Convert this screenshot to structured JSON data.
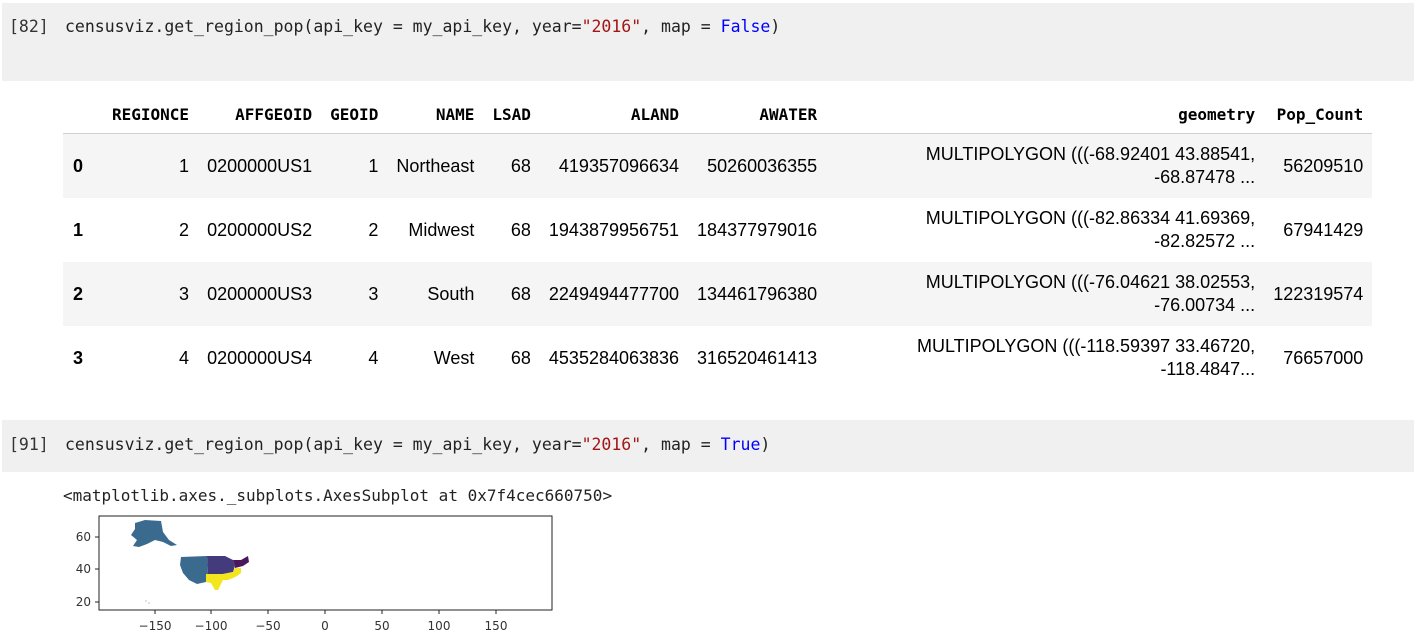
{
  "cells": [
    {
      "prompt": "[82]",
      "code_parts": [
        "censusviz.get_region_pop(api_key = my_api_key, year=",
        "\"2016\"",
        ", map = ",
        "False",
        ")"
      ]
    },
    {
      "prompt": "[91]",
      "code_parts": [
        "censusviz.get_region_pop(api_key = my_api_key, year=",
        "\"2016\"",
        ", map = ",
        "True",
        ")"
      ]
    }
  ],
  "dataframe": {
    "columns": [
      "",
      "REGIONCE",
      "AFFGEOID",
      "GEOID",
      "NAME",
      "LSAD",
      "ALAND",
      "AWATER",
      "geometry",
      "Pop_Count"
    ],
    "rows": [
      {
        "idx": "0",
        "REGIONCE": "1",
        "AFFGEOID": "0200000US1",
        "GEOID": "1",
        "NAME": "Northeast",
        "LSAD": "68",
        "ALAND": "419357096634",
        "AWATER": "50260036355",
        "geometry_1": "MULTIPOLYGON (((-68.92401 43.88541,",
        "geometry_2": "-68.87478 ...",
        "Pop_Count": "56209510"
      },
      {
        "idx": "1",
        "REGIONCE": "2",
        "AFFGEOID": "0200000US2",
        "GEOID": "2",
        "NAME": "Midwest",
        "LSAD": "68",
        "ALAND": "1943879956751",
        "AWATER": "184377979016",
        "geometry_1": "MULTIPOLYGON (((-82.86334 41.69369,",
        "geometry_2": "-82.82572 ...",
        "Pop_Count": "67941429"
      },
      {
        "idx": "2",
        "REGIONCE": "3",
        "AFFGEOID": "0200000US3",
        "GEOID": "3",
        "NAME": "South",
        "LSAD": "68",
        "ALAND": "2249494477700",
        "AWATER": "134461796380",
        "geometry_1": "MULTIPOLYGON (((-76.04621 38.02553,",
        "geometry_2": "-76.00734 ...",
        "Pop_Count": "122319574"
      },
      {
        "idx": "3",
        "REGIONCE": "4",
        "AFFGEOID": "0200000US4",
        "GEOID": "4",
        "NAME": "West",
        "LSAD": "68",
        "ALAND": "4535284063836",
        "AWATER": "316520461413",
        "geometry_1": "MULTIPOLYGON (((-118.59397 33.46720,",
        "geometry_2": "-118.4847...",
        "Pop_Count": "76657000"
      }
    ]
  },
  "output_text": "<matplotlib.axes._subplots.AxesSubplot at 0x7f4cec660750>",
  "plot": {
    "xticks": [
      "−150",
      "−100",
      "−50",
      "0",
      "50",
      "100",
      "150"
    ],
    "yticks": [
      "60",
      "40",
      "20"
    ],
    "colors": {
      "west": "#3b6a8f",
      "midwest": "#433b7c",
      "northeast": "#4b165c",
      "south": "#f3e51e"
    }
  }
}
